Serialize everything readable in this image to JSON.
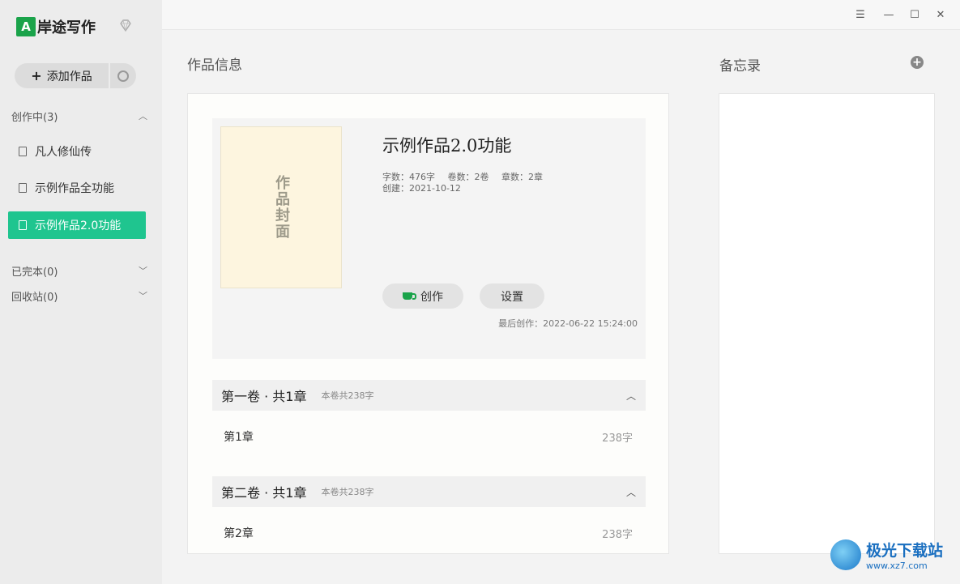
{
  "app": {
    "logo_mark": "A",
    "name": "岸途写作"
  },
  "sidebar": {
    "add_label": "添加作品",
    "groups": [
      {
        "label": "创作中(3)",
        "expanded": true
      },
      {
        "label": "已完本(0)",
        "expanded": false
      },
      {
        "label": "回收站(0)",
        "expanded": false
      }
    ],
    "works": [
      {
        "label": "凡人修仙传",
        "active": false
      },
      {
        "label": "示例作品全功能",
        "active": false
      },
      {
        "label": "示例作品2.0功能",
        "active": true
      }
    ]
  },
  "window_controls": {
    "menu": "☰",
    "minimize": "—",
    "maximize": "☐",
    "close": "✕"
  },
  "main": {
    "section_title": "作品信息",
    "cover_text": "作品封面",
    "work_title": "示例作品2.0功能",
    "stats": {
      "words": "字数：476字",
      "volumes": "卷数：2卷",
      "chapters": "章数：2章",
      "created": "创建：2021-10-12"
    },
    "create_button": "创作",
    "settings_button": "设置",
    "last_created": "最后创作：2022-06-22 15:24:00",
    "volumes": [
      {
        "title": "第一卷 · 共1章",
        "count": "本卷共238字",
        "chapters": [
          {
            "name": "第1章",
            "words": "238字"
          }
        ]
      },
      {
        "title": "第二卷 · 共1章",
        "count": "本卷共238字",
        "chapters": [
          {
            "name": "第2章",
            "words": "238字"
          }
        ]
      }
    ]
  },
  "memo": {
    "title": "备忘录",
    "add_icon": "+"
  },
  "watermark": {
    "main": "极光下载站",
    "url": "www.xz7.com"
  },
  "colors": {
    "accent": "#1fc58f",
    "brand_green": "#1aa34a"
  }
}
